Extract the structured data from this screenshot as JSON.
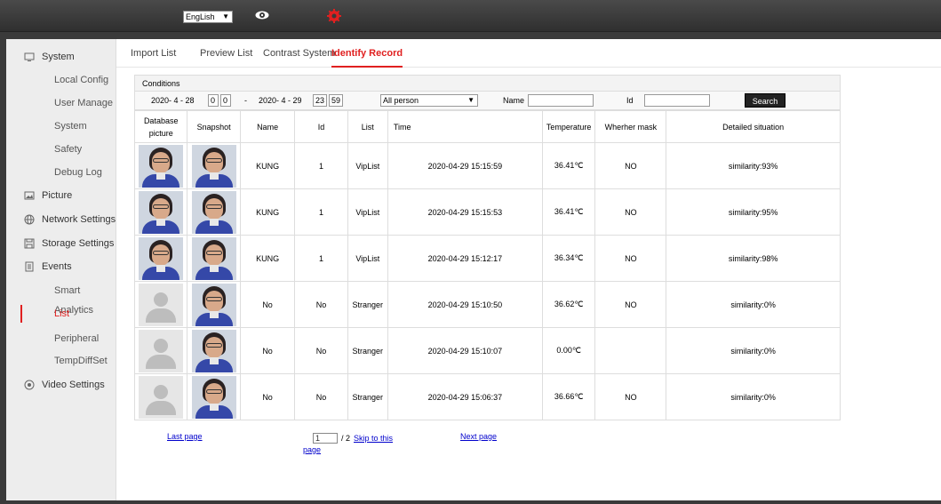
{
  "topbar": {
    "language": "EngLish",
    "eye_icon": "eye-icon",
    "settings_icon": "gear-icon",
    "accent_color": "#e02020"
  },
  "sidebar": {
    "sections": [
      {
        "label": "System",
        "icon": "monitor-icon"
      },
      {
        "label": "Picture",
        "icon": "picture-icon"
      },
      {
        "label": "Network Settings",
        "icon": "globe-icon"
      },
      {
        "label": "Storage Settings",
        "icon": "floppy-icon"
      },
      {
        "label": "Events",
        "icon": "document-icon"
      },
      {
        "label": "Video Settings",
        "icon": "camera-icon"
      }
    ],
    "system_items": [
      "Local Config",
      "User Manage",
      "System",
      "Safety",
      "Debug Log"
    ],
    "event_items": [
      "Smart Analytics",
      "List",
      "Peripheral",
      "TempDiffSet"
    ],
    "active_item": "List"
  },
  "tabs": [
    "Import List",
    "Preview List",
    "Contrast System",
    "Identify Record"
  ],
  "active_tab": "Identify Record",
  "filter": {
    "title": "Conditions",
    "start_date": "2020- 4 - 28",
    "start_hour": "0",
    "start_min": "0",
    "separator": "-",
    "end_date": "2020- 4 - 29",
    "end_hour": "23",
    "end_min": "59",
    "person_select": "All person",
    "name_label": "Name",
    "name_value": "",
    "id_label": "Id",
    "id_value": "",
    "search_label": "Search"
  },
  "table": {
    "headers": [
      "Database picture",
      "Snapshot",
      "Name",
      "Id",
      "List",
      "Time",
      "Temperature",
      "Wherher mask",
      "Detailed situation"
    ],
    "rows": [
      {
        "db": "face",
        "name": "KUNG",
        "id": "1",
        "list": "VipList",
        "time": "2020-04-29 15:15:59",
        "temp": "36.41℃",
        "mask": "NO",
        "detail": "similarity:93%"
      },
      {
        "db": "face",
        "name": "KUNG",
        "id": "1",
        "list": "VipList",
        "time": "2020-04-29 15:15:53",
        "temp": "36.41℃",
        "mask": "NO",
        "detail": "similarity:95%"
      },
      {
        "db": "face",
        "name": "KUNG",
        "id": "1",
        "list": "VipList",
        "time": "2020-04-29 15:12:17",
        "temp": "36.34℃",
        "mask": "NO",
        "detail": "similarity:98%"
      },
      {
        "db": "blank",
        "name": "No",
        "id": "No",
        "list": "Stranger",
        "time": "2020-04-29 15:10:50",
        "temp": "36.62℃",
        "mask": "NO",
        "detail": "similarity:0%"
      },
      {
        "db": "blank",
        "name": "No",
        "id": "No",
        "list": "Stranger",
        "time": "2020-04-29 15:10:07",
        "temp": "0.00℃",
        "mask": "",
        "detail": "similarity:0%"
      },
      {
        "db": "blank",
        "name": "No",
        "id": "No",
        "list": "Stranger",
        "time": "2020-04-29 15:06:37",
        "temp": "36.66℃",
        "mask": "NO",
        "detail": "similarity:0%"
      }
    ]
  },
  "pager": {
    "last_page": "Last page",
    "page_input": "1",
    "total": "/ 2",
    "skip_1": "Skip to this",
    "skip_2": "page",
    "next_page": "Next page"
  }
}
